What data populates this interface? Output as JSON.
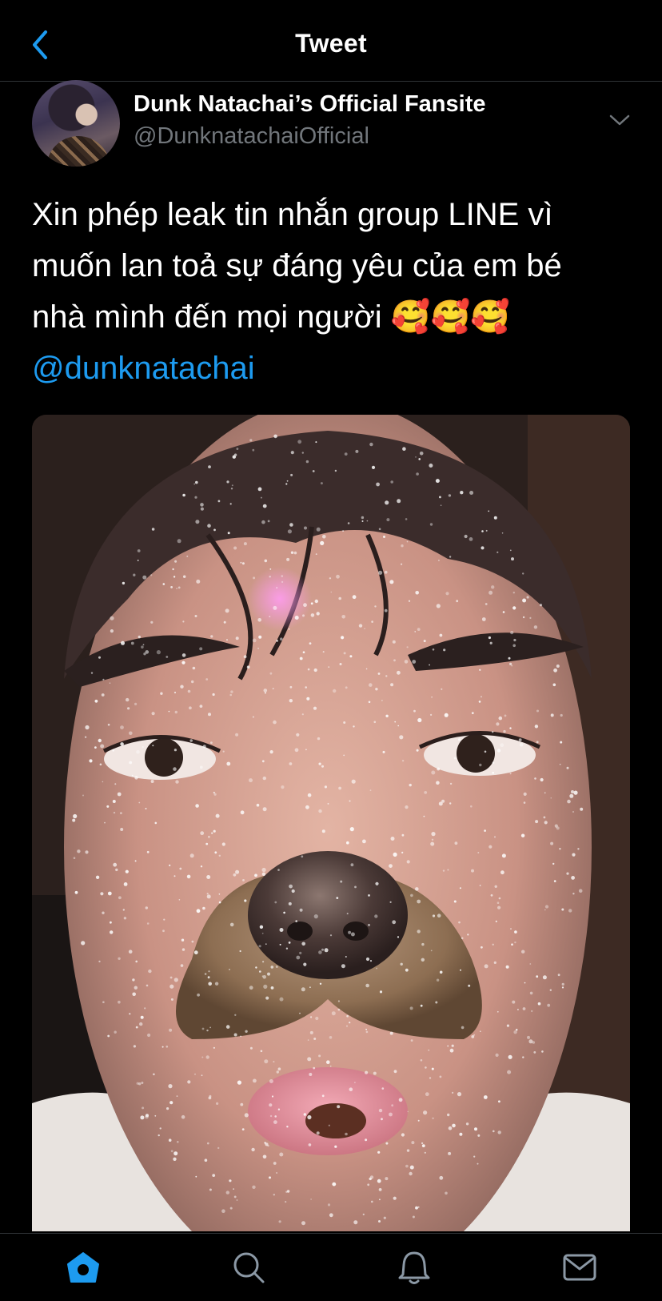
{
  "header": {
    "title": "Tweet",
    "back_icon": "chevron-left-icon"
  },
  "tweet": {
    "author_name": "Dunk Natachai’s Official Fansite",
    "author_handle": "@DunknatachaiOfficial",
    "text_lines": [
      "Xin phép leak tin nhắn group LINE vì",
      "muốn lan toả sự đáng yêu của em bé",
      "nhà mình đến mọi người 🥰🥰🥰"
    ],
    "mention": "@dunknatachai"
  },
  "bottom_nav": {
    "items": [
      "home-icon",
      "search-icon",
      "notifications-icon",
      "messages-icon"
    ],
    "active": "home-icon"
  },
  "colors": {
    "background": "#000000",
    "accent": "#1d9bf0",
    "secondary_text": "#71767b",
    "divider": "#2f3336"
  }
}
